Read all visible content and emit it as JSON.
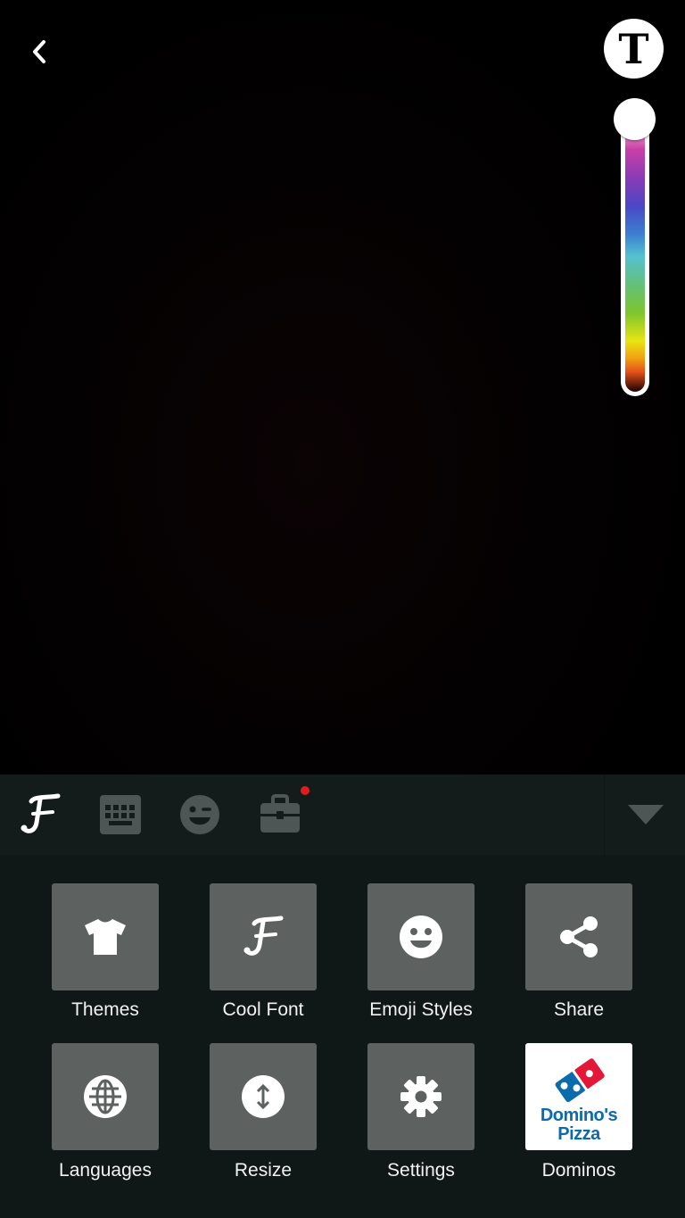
{
  "top_bar": {
    "back_icon": "chevron-left-icon",
    "text_style_icon": "serif-T-icon",
    "text_style_glyph": "T"
  },
  "color_slider": {
    "selected_color": "#ffffff",
    "level": 0.0
  },
  "keyboard_tabs": [
    {
      "name": "cool-font-logo-tab",
      "icon": "fancy-F-icon"
    },
    {
      "name": "keyboard-tab",
      "icon": "keyboard-icon"
    },
    {
      "name": "emoji-tab",
      "icon": "wink-emoji-icon"
    },
    {
      "name": "toolbox-tab",
      "icon": "briefcase-icon",
      "badge_color": "#e21c1c"
    }
  ],
  "menu": {
    "items": [
      {
        "label": "Themes",
        "icon": "tshirt-icon"
      },
      {
        "label": "Cool Font",
        "icon": "fancy-F-icon"
      },
      {
        "label": "Emoji Styles",
        "icon": "smiley-icon"
      },
      {
        "label": "Share",
        "icon": "share-icon"
      },
      {
        "label": "Languages",
        "icon": "globe-icon"
      },
      {
        "label": "Resize",
        "icon": "resize-vertical-icon"
      },
      {
        "label": "Settings",
        "icon": "gear-icon"
      },
      {
        "label": "Dominos",
        "icon": "dominos-logo",
        "logo_text_line1": "Domino's",
        "logo_text_line2": "Pizza"
      }
    ]
  },
  "colors": {
    "canvas_bg": "#000000",
    "keyboard_bar_bg": "#141b1b",
    "panel_bg": "#101717",
    "tile_bg": "#5d6261",
    "dominos_blue": "#0b6bab",
    "dominos_red": "#e31837"
  }
}
